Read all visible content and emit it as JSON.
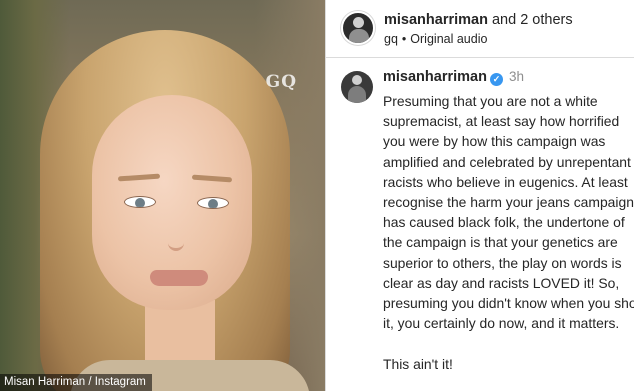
{
  "media": {
    "watermark": "GQ",
    "credit": "Misan Harriman / Instagram"
  },
  "header": {
    "username": "misanharriman",
    "and_others": " and 2 others",
    "account": "gq",
    "separator": "•",
    "audio": "Original audio",
    "more_icon": "more-options-icon"
  },
  "comment": {
    "username": "misanharriman",
    "verified_icon": "verified-badge-icon",
    "time": "3h",
    "paragraphs": [
      "Presuming that you are not a white supremacist, at least say how horrified you were by how this campaign was amplified and celebrated by unrepentant racists who believe in eugenics. At least recognise the harm your jeans campaign has caused black folk, the undertone of the campaign is that your genetics are superior to others, the play on words is clear as day and racists LOVED it! So, presuming you didn't know when you shot it, you certainly do now, and it matters.",
      "This ain't it!"
    ]
  },
  "colors": {
    "verified": "#3897f0",
    "muted_text": "#8e8e8e",
    "text": "#262626",
    "divider": "#dbdbdb"
  }
}
